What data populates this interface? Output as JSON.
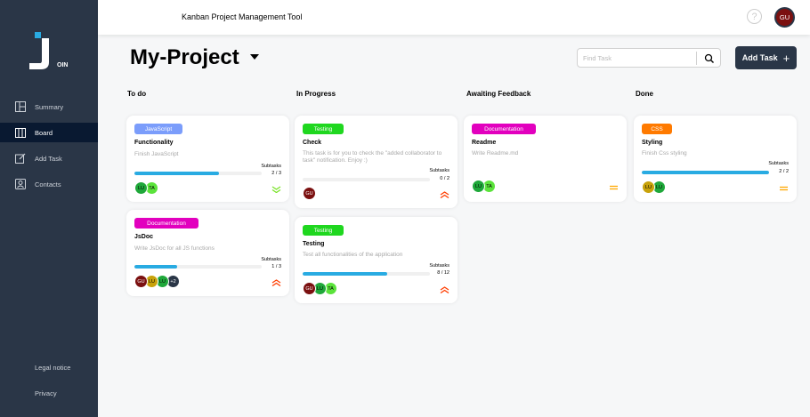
{
  "header": {
    "title": "Kanban Project Management Tool",
    "help_glyph": "?",
    "user_initials": "GU"
  },
  "sidebar": {
    "logo_text": "OIN",
    "items": [
      {
        "label": "Summary",
        "icon": "summary-icon"
      },
      {
        "label": "Board",
        "icon": "board-icon",
        "active": true
      },
      {
        "label": "Add Task",
        "icon": "edit-icon"
      },
      {
        "label": "Contacts",
        "icon": "contacts-icon"
      }
    ],
    "footer": {
      "legal": "Legal notice",
      "privacy": "Privacy"
    }
  },
  "board": {
    "project_title": "My-Project",
    "search_placeholder": "Find Task",
    "add_task_label": "Add Task",
    "add_task_glyph": "+",
    "columns": [
      {
        "title": "To do"
      },
      {
        "title": "In Progress"
      },
      {
        "title": "Awaiting Feedback"
      },
      {
        "title": "Done"
      }
    ]
  },
  "cards": [
    {
      "tag": "JavaScript",
      "tag_color": "#7b9dfb",
      "title": "Functionality",
      "desc": "Finish JavaScript",
      "subtasks_label": "Subtasks",
      "subtasks": "2 / 3",
      "progress": 0.667,
      "avatars": [
        {
          "t": "LU",
          "c": "#1fa83a"
        },
        {
          "t": "TA",
          "c": "#5be33b"
        }
      ],
      "priority": "low"
    },
    {
      "tag": "Documentation",
      "tag_color": "#e200be",
      "title": "JsDoc",
      "desc": "Write JsDoc for all JS functions",
      "subtasks_label": "Subtasks",
      "subtasks": "1 / 3",
      "progress": 0.333,
      "avatars": [
        {
          "t": "GU",
          "c": "#7b1010"
        },
        {
          "t": "LU",
          "c": "#c8a20a"
        },
        {
          "t": "LU",
          "c": "#1fa83a"
        },
        {
          "t": "+2",
          "c": "#2a3647"
        }
      ],
      "priority": "urgent"
    },
    {
      "tag": "Testing",
      "tag_color": "#1fd71f",
      "title": "Check",
      "desc": "This task is for you to check the \"added collaborator to task\" notification. Enjoy :)",
      "subtasks_label": "Subtasks",
      "subtasks": "0 / 2",
      "progress": 0,
      "avatars": [
        {
          "t": "GU",
          "c": "#7b1010"
        }
      ],
      "priority": "urgent"
    },
    {
      "tag": "Testing",
      "tag_color": "#1fd71f",
      "title": "Testing",
      "desc": "Test all functionalities of the application",
      "subtasks_label": "Subtasks",
      "subtasks": "8 / 12",
      "progress": 0.667,
      "avatars": [
        {
          "t": "GU",
          "c": "#7b1010"
        },
        {
          "t": "LU",
          "c": "#1fa83a"
        },
        {
          "t": "TA",
          "c": "#5be33b"
        }
      ],
      "priority": "urgent"
    },
    {
      "tag": "Documentation",
      "tag_color": "#e200be",
      "title": "Readme",
      "desc": "Write Readme.md",
      "avatars": [
        {
          "t": "LU",
          "c": "#1fa83a"
        },
        {
          "t": "TA",
          "c": "#5be33b"
        }
      ],
      "priority": "medium"
    },
    {
      "tag": "CSS",
      "tag_color": "#ff7a00",
      "title": "Styling",
      "desc": "Finish Css styling",
      "subtasks_label": "Subtasks",
      "subtasks": "2 / 2",
      "progress": 1,
      "avatars": [
        {
          "t": "LU",
          "c": "#c8a20a"
        },
        {
          "t": "LU",
          "c": "#1fa83a"
        }
      ],
      "priority": "medium"
    }
  ],
  "colors": {
    "sidebar": "#2a3647",
    "sidebar_active": "#091931",
    "progress": "#29abe2",
    "priority_urgent": "#ff3d00",
    "priority_medium": "#ffa800",
    "priority_low": "#7ae229"
  }
}
